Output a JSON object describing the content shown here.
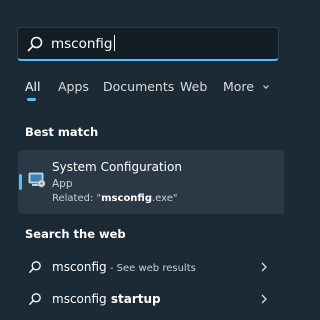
{
  "search": {
    "query": "msconfig"
  },
  "tabs": [
    {
      "label": "All",
      "active": true
    },
    {
      "label": "Apps"
    },
    {
      "label": "Documents"
    },
    {
      "label": "Web"
    },
    {
      "label": "More"
    }
  ],
  "best_match": {
    "title": "Best match",
    "app_name": "System Configuration",
    "app_type": "App",
    "related_prefix": "Related: \"",
    "related_value": "msconfig",
    "related_suffix": ".exe\"",
    "icon": "system-configuration-icon"
  },
  "search_web": {
    "title": "Search the web",
    "results": [
      {
        "term": "msconfig",
        "suffix": " - See web results",
        "icon": "search-icon"
      },
      {
        "term": "msconfig",
        "bold_part": " startup",
        "icon": "search-icon"
      }
    ]
  },
  "colors": {
    "background": "#1c2a36",
    "accent": "#4cc2ff",
    "card": "#2a3945"
  }
}
